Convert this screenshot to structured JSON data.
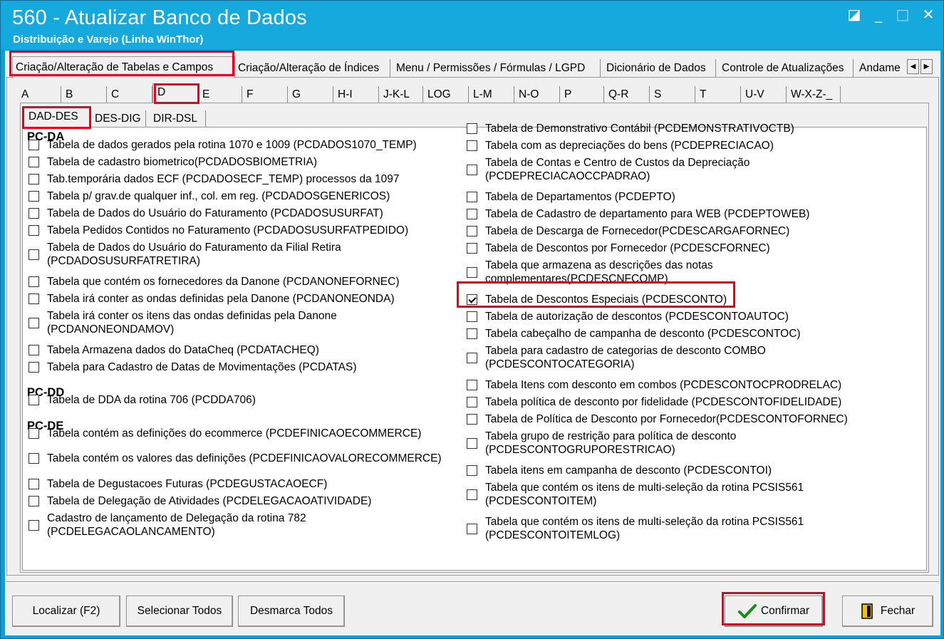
{
  "window": {
    "title": "560 - Atualizar Banco de Dados",
    "subtitle": "Distribuição e Varejo (Linha WinThor)",
    "buttons": {
      "restore": "◪",
      "minimize": "_",
      "maximize": "□",
      "close": "✕"
    }
  },
  "main_tabs": [
    "Criação/Alteração de Tabelas e Campos",
    "Criação/Alteração de Índices",
    "Menu / Permissões / Fórmulas / LGPD",
    "Dicionário de Dados",
    "Controle de Atualizações",
    "Andame"
  ],
  "letter_tabs": [
    "A",
    "B",
    "C",
    "D",
    "E",
    "F",
    "G",
    "H-I",
    "J-K-L",
    "LOG",
    "L-M",
    "N-O",
    "P",
    "Q-R",
    "S",
    "T",
    "U-V",
    "W-X-Z-_"
  ],
  "sub_tabs": [
    "DAD-DES",
    "DES-DIG",
    "DIR-DSL"
  ],
  "left_column": {
    "groups": [
      "PC-DA",
      "PC-DD",
      "PC-DE"
    ],
    "items": [
      "Tabela de dados gerados pela rotina 1070 e 1009 (PCDADOS1070_TEMP)",
      "Tabela de cadastro biometrico(PCDADOSBIOMETRIA)",
      "Tab.temporária dados ECF (PCDADOSECF_TEMP) processos da 1097",
      "Tabela p/ grav.de qualquer  inf., col. em reg. (PCDADOSGENERICOS)",
      "Tabela de Dados do Usuário do Faturamento (PCDADOSUSURFAT)",
      "Tabela  Pedidos Contidos no Faturamento (PCDADOSUSURFATPEDIDO)",
      "Tabela de Dados do Usuário do Faturamento da Filial Retira (PCDADOSUSURFATRETIRA)",
      "Tabela que contém os fornecedores da Danone (PCDANONEFORNEC)",
      "Tabela irá conter as ondas definidas pela Danone (PCDANONEONDA)",
      "Tabela irá conter os itens das ondas definidas pela Danone (PCDANONEONDAMOV)",
      "Tabela Armazena dados do DataCheq (PCDATACHEQ)",
      "Tabela para Cadastro de Datas de Movimentações (PCDATAS)",
      "Tabela de DDA da rotina 706 (PCDDA706)",
      "Tabela contém as definições do ecommerce (PCDEFINICAOECOMMERCE)",
      "Tabela contém os valores das definições (PCDEFINICAOVALORECOMMERCE)",
      "Tabela de Degustacoes Futuras (PCDEGUSTACAOECF)",
      "Tabela de Delegação de Atividades (PCDELEGACAOATIVIDADE)",
      "Cadastro de lançamento de Delegação da rotina 782 (PCDELEGACAOLANCAMENTO)"
    ]
  },
  "right_column": {
    "items": [
      "Tabela de Demonstrativo Contábil (PCDEMONSTRATIVOCTB)",
      "Tabela com as depreciações do bens (PCDEPRECIACAO)",
      "Tabela de Contas e Centro de Custos da Depreciação (PCDEPRECIACAOCCPADRAO)",
      "Tabela de Departamentos (PCDEPTO)",
      "Tabela de Cadastro de departamento para WEB (PCDEPTOWEB)",
      "Tabela de Descarga de  Fornecedor(PCDESCARGAFORNEC)",
      "Tabela de Descontos por Fornecedor (PCDESCFORNEC)",
      "Tabela que armazena as descrições das notas complementares(PCDESCNFCOMP)",
      "Tabela de Descontos Especiais (PCDESCONTO)",
      "Tabela de autorização de descontos (PCDESCONTOAUTOC)",
      "Tabela cabeçalho de campanha de desconto (PCDESCONTOC)",
      "Tabela para cadastro de categorias de desconto COMBO (PCDESCONTOCATEGORIA)",
      "Tabela Itens com desconto em combos (PCDESCONTOCPRODRELAC)",
      "Tabela política de desconto por fidelidade (PCDESCONTOFIDELIDADE)",
      "Tabela de Política de  Desconto por Fornecedor(PCDESCONTOFORNEC)",
      "Tabela grupo de restrição para política de desconto (PCDESCONTOGRUPORESTRICAO)",
      "Tabela itens em campanha de desconto (PCDESCONTOI)",
      "Tabela que contém os itens de multi-seleção da rotina PCSIS561 (PCDESCONTOITEM)",
      "Tabela que contém os itens de multi-seleção da rotina PCSIS561 (PCDESCONTOITEMLOG)"
    ],
    "checked_item": "Tabela de Descontos Especiais (PCDESCONTO)"
  },
  "buttons": {
    "localizar": "Localizar (F2)",
    "selecionar": "Selecionar Todos",
    "desmarca": "Desmarca Todos",
    "confirmar": "Confirmar",
    "fechar": "Fechar"
  },
  "colors": {
    "titlebar": "#16a9de",
    "highlight": "#e8001c",
    "confirm_check": "#1a8c1a",
    "fechar_icon": "#e0b000"
  }
}
